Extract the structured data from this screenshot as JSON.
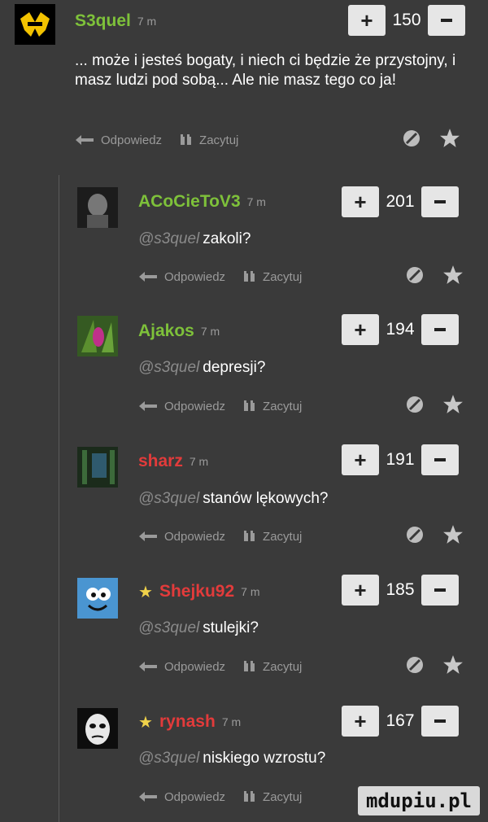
{
  "labels": {
    "reply": "Odpowiedz",
    "quote": "Zacytuj"
  },
  "colors": {
    "green_user": "#7ec13a",
    "red_user": "#e23b3b",
    "star": "#f0d24a"
  },
  "comments": [
    {
      "username": "S3quel",
      "time": "7 m",
      "votes": "150",
      "text": "... może i jesteś bogaty, i niech ci będzie że przystojny, i masz ludzi pod sobą... Ale nie masz tego co ja!",
      "mention": ""
    },
    {
      "username": "ACoCieToV3",
      "time": "7 m",
      "votes": "201",
      "mention": "@s3quel",
      "text": "zakoli?"
    },
    {
      "username": "Ajakos",
      "time": "7 m",
      "votes": "194",
      "mention": "@s3quel",
      "text": "depresji?"
    },
    {
      "username": "sharz",
      "time": "7 m",
      "votes": "191",
      "mention": "@s3quel",
      "text": "stanów lękowych?"
    },
    {
      "username": "Shejku92",
      "time": "7 m",
      "votes": "185",
      "mention": "@s3quel",
      "text": "stulejki?"
    },
    {
      "username": "rynash",
      "time": "7 m",
      "votes": "167",
      "mention": "@s3quel",
      "text": "niskiego wzrostu?"
    }
  ],
  "watermark": "mdupiu.pl"
}
